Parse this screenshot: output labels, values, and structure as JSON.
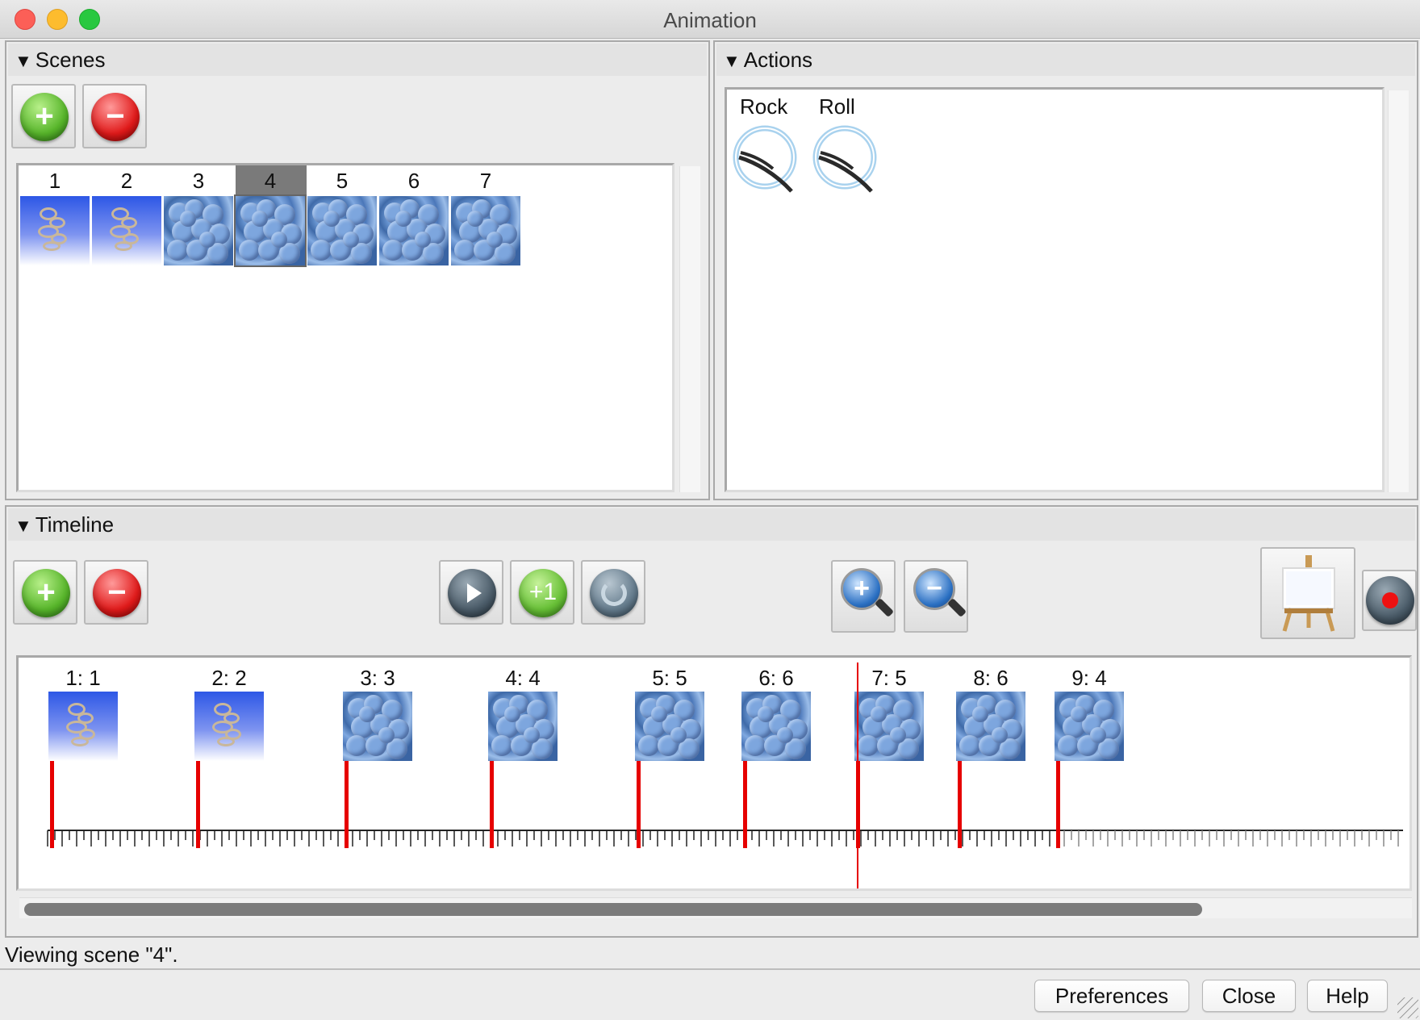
{
  "window": {
    "title": "Animation"
  },
  "scenes": {
    "header": "Scenes",
    "add_label": "+",
    "remove_label": "−",
    "items": [
      {
        "num": "1",
        "kind": "ribbon"
      },
      {
        "num": "2",
        "kind": "ribbon"
      },
      {
        "num": "3",
        "kind": "surface"
      },
      {
        "num": "4",
        "kind": "surface",
        "selected": true
      },
      {
        "num": "5",
        "kind": "surface"
      },
      {
        "num": "6",
        "kind": "surface"
      },
      {
        "num": "7",
        "kind": "surface"
      }
    ]
  },
  "actions": {
    "header": "Actions",
    "items": [
      {
        "label": "Rock",
        "icon": "rock-icon"
      },
      {
        "label": "Roll",
        "icon": "roll-icon"
      }
    ]
  },
  "timeline": {
    "header": "Timeline",
    "controls": {
      "add": "+",
      "remove": "−",
      "play": "play-icon",
      "plus_one": "+1",
      "loop": "loop-icon",
      "zoom_in": "+",
      "zoom_out": "−",
      "record": "record-icon"
    },
    "keyframes": [
      {
        "label": "1: 1",
        "kind": "ribbon"
      },
      {
        "label": "2: 2",
        "kind": "ribbon"
      },
      {
        "label": "3: 3",
        "kind": "surface"
      },
      {
        "label": "4: 4",
        "kind": "surface"
      },
      {
        "label": "5: 5",
        "kind": "surface"
      },
      {
        "label": "6: 6",
        "kind": "surface"
      },
      {
        "label": "7: 5",
        "kind": "surface"
      },
      {
        "label": "8: 6",
        "kind": "surface"
      },
      {
        "label": "9: 4",
        "kind": "surface"
      }
    ]
  },
  "status": "Viewing scene \"4\".",
  "footer": {
    "preferences": "Preferences",
    "close": "Close",
    "help": "Help"
  },
  "colors": {
    "marker": "#e60000",
    "green_button": "#57b52a",
    "red_button": "#e01a1a"
  }
}
